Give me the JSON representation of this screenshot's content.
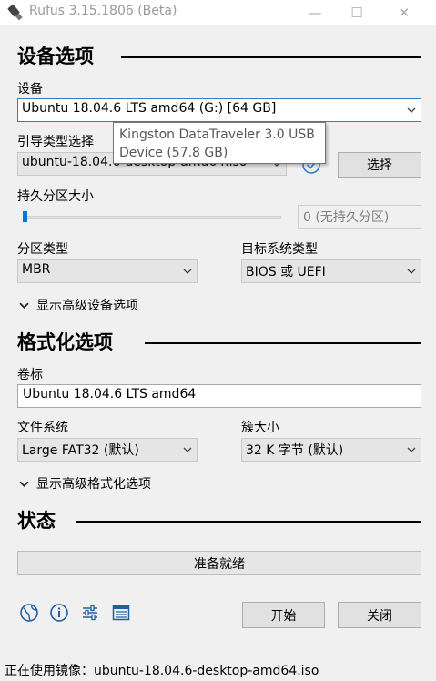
{
  "window": {
    "title": "Rufus 3.15.1806 (Beta)",
    "minimize": "—",
    "maximize": "☐",
    "close": "✕"
  },
  "drive_section": {
    "title": "设备选项",
    "device_label": "设备",
    "device_value": "Ubuntu 18.04.6 LTS amd64 (G:) [64 GB]",
    "tooltip_line1": "Kingston DataTraveler 3.0 USB",
    "tooltip_line2": "Device (57.8 GB)",
    "boot_label": "引导类型选择",
    "boot_value": "ubuntu-18.04.6-desktop-amd64.iso",
    "select_button": "选择",
    "persistent_label": "持久分区大小",
    "persistent_value": "0 (无持久分区)",
    "persistent_slider_fraction": 0,
    "partition_label": "分区类型",
    "partition_value": "MBR",
    "target_label": "目标系统类型",
    "target_value": "BIOS 或 UEFI",
    "advanced_toggle": "显示高级设备选项"
  },
  "format_section": {
    "title": "格式化选项",
    "volume_label": "卷标",
    "volume_value": "Ubuntu 18.04.6 LTS amd64",
    "fs_label": "文件系统",
    "fs_value": "Large FAT32 (默认)",
    "cluster_label": "簇大小",
    "cluster_value": "32 K 字节 (默认)",
    "advanced_toggle": "显示高级格式化选项"
  },
  "status_section": {
    "title": "状态",
    "progress_text": "准备就绪",
    "progress_fraction": 0
  },
  "toolbar": {
    "start_button": "开始",
    "close_button": "关闭"
  },
  "statusbar": {
    "text": "正在使用镜像：ubuntu-18.04.6-desktop-amd64.iso"
  },
  "colors": {
    "accent": "#2d7fd0",
    "slider_thumb": "#0078d7",
    "icon_blue": "#1f5fa8",
    "window_bg": "#f0f0f0"
  },
  "icons": [
    "usb-drive-icon",
    "check-circle-icon",
    "globe-icon",
    "info-icon",
    "settings-sliders-icon",
    "log-list-icon",
    "chevron-down-icon"
  ]
}
